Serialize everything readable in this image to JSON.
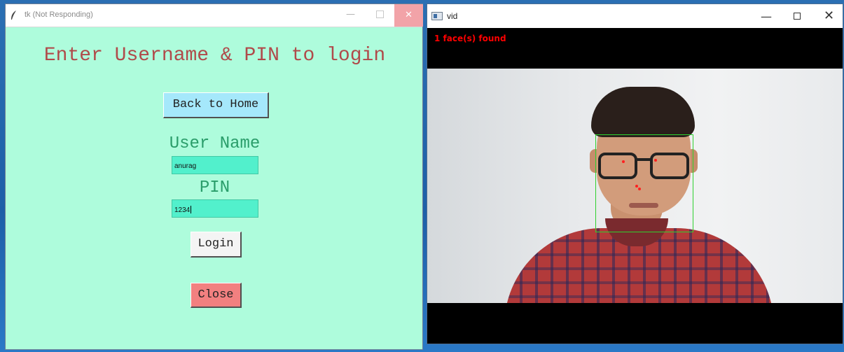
{
  "login_window": {
    "title": "tk (Not Responding)",
    "heading": "Enter Username & PIN to login",
    "back_button": "Back to Home",
    "username_label": "User Name",
    "username_value": "anurag",
    "pin_label": "PIN",
    "pin_value": "1234",
    "login_button": "Login",
    "close_button": "Close",
    "controls": {
      "minimize": "—",
      "close": "✕"
    }
  },
  "video_window": {
    "title": "vid",
    "overlay_text": "1 face(s) found",
    "controls": {
      "minimize": "—",
      "close": "✕"
    }
  },
  "colors": {
    "login_bg": "#aefcdc",
    "heading": "#b04a4a",
    "label": "#2a9d6a",
    "field_bg": "#52f0cc",
    "home_button": "#a5e8fb",
    "close_button": "#f28080",
    "overlay_text": "#ff0000",
    "face_box": "#2fd12f"
  }
}
